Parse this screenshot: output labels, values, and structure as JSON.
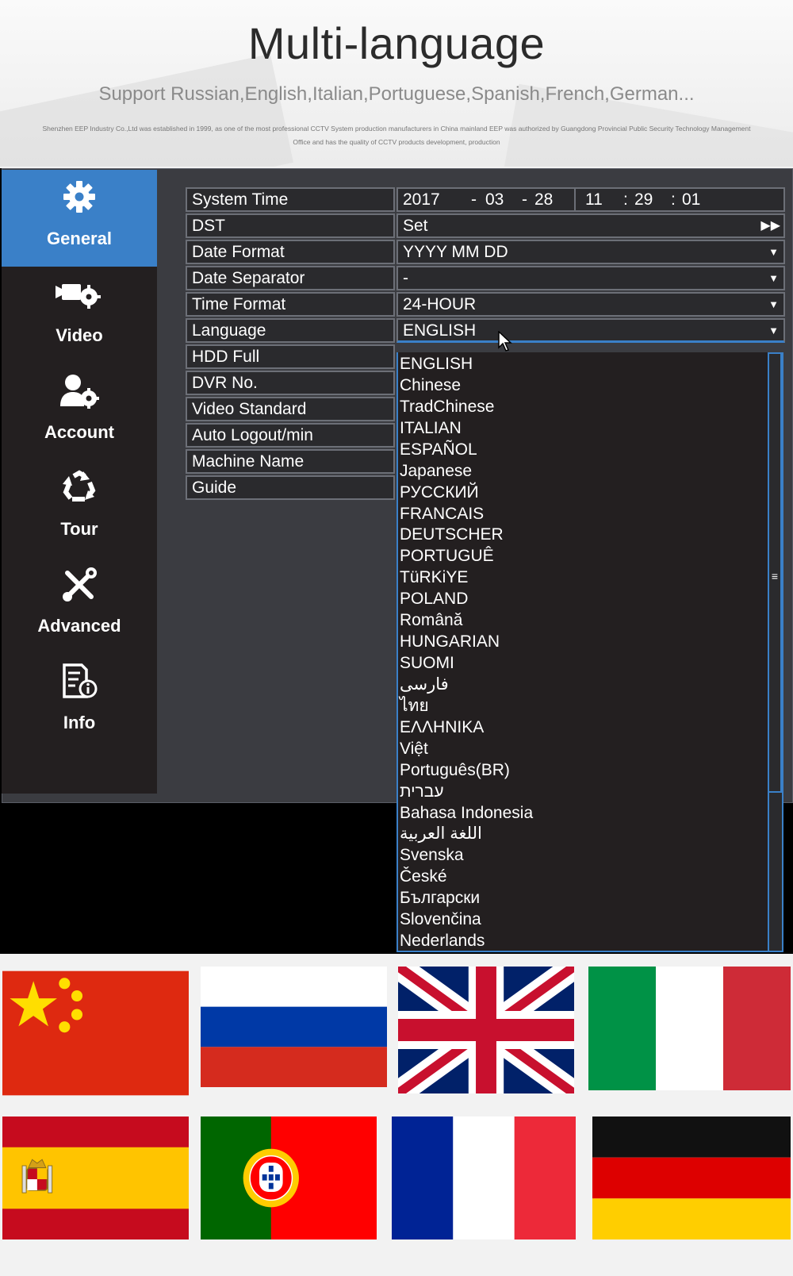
{
  "header": {
    "title": "Multi-language",
    "subtitle": "Support Russian,English,Italian,Portuguese,Spanish,French,German...",
    "company_line_1": "Shenzhen EEP Industry Co.,Ltd was established in 1999, as one of the most professional CCTV System production manufacturers in China mainland EEP was authorized by Guangdong Provincial Public Security Technology Management",
    "company_line_2": "Office and has the quality of CCTV products development, production"
  },
  "sidebar": {
    "items": [
      {
        "label": "General",
        "icon": "gear-icon",
        "active": true
      },
      {
        "label": "Video",
        "icon": "camera-gear-icon",
        "active": false
      },
      {
        "label": "Account",
        "icon": "user-gear-icon",
        "active": false
      },
      {
        "label": "Tour",
        "icon": "recycle-icon",
        "active": false
      },
      {
        "label": "Advanced",
        "icon": "tools-icon",
        "active": false
      },
      {
        "label": "Info",
        "icon": "document-info-icon",
        "active": false
      }
    ]
  },
  "settings": {
    "system_time": {
      "label": "System Time",
      "year": "2017",
      "month": "03",
      "day": "28",
      "hour": "11",
      "minute": "29",
      "second": "01",
      "date_sep": "-",
      "time_sep": ":"
    },
    "dst": {
      "label": "DST",
      "value": "Set"
    },
    "date_format": {
      "label": "Date Format",
      "value": "YYYY MM DD"
    },
    "date_separator": {
      "label": "Date Separator",
      "value": "-"
    },
    "time_format": {
      "label": "Time Format",
      "value": "24-HOUR"
    },
    "language": {
      "label": "Language",
      "value": "ENGLISH"
    },
    "hdd_full": {
      "label": "HDD Full"
    },
    "dvr_no": {
      "label": "DVR No."
    },
    "video_standard": {
      "label": "Video Standard"
    },
    "auto_logout": {
      "label": "Auto Logout/min"
    },
    "machine_name": {
      "label": "Machine Name"
    },
    "guide": {
      "label": "Guide"
    }
  },
  "language_options": [
    "ENGLISH",
    "Chinese",
    "TradChinese",
    "ITALIAN",
    "ESPAÑOL",
    "Japanese",
    "РУССКИЙ",
    "FRANCAIS",
    "DEUTSCHER",
    "PORTUGUÊ",
    "TüRKiYE",
    "POLAND",
    "Română",
    "HUNGARIAN",
    "SUOMI",
    "فارسی",
    "ไทย",
    "ΕΛΛΗΝΙΚΑ",
    "Việt",
    "Português(BR)",
    "עברית",
    "Bahasa Indonesia",
    "اللغة العربية",
    "Svenska",
    "České",
    "Български",
    "Slovenčina",
    "Nederlands"
  ],
  "flags": [
    "china-flag",
    "russia-flag",
    "uk-flag",
    "italy-flag",
    "spain-flag",
    "portugal-flag",
    "france-flag",
    "germany-flag"
  ],
  "colors": {
    "accent": "#3a80c8",
    "panel": "#3b3c41",
    "cell": "#2a2a2d",
    "sidebar": "#231f20"
  }
}
